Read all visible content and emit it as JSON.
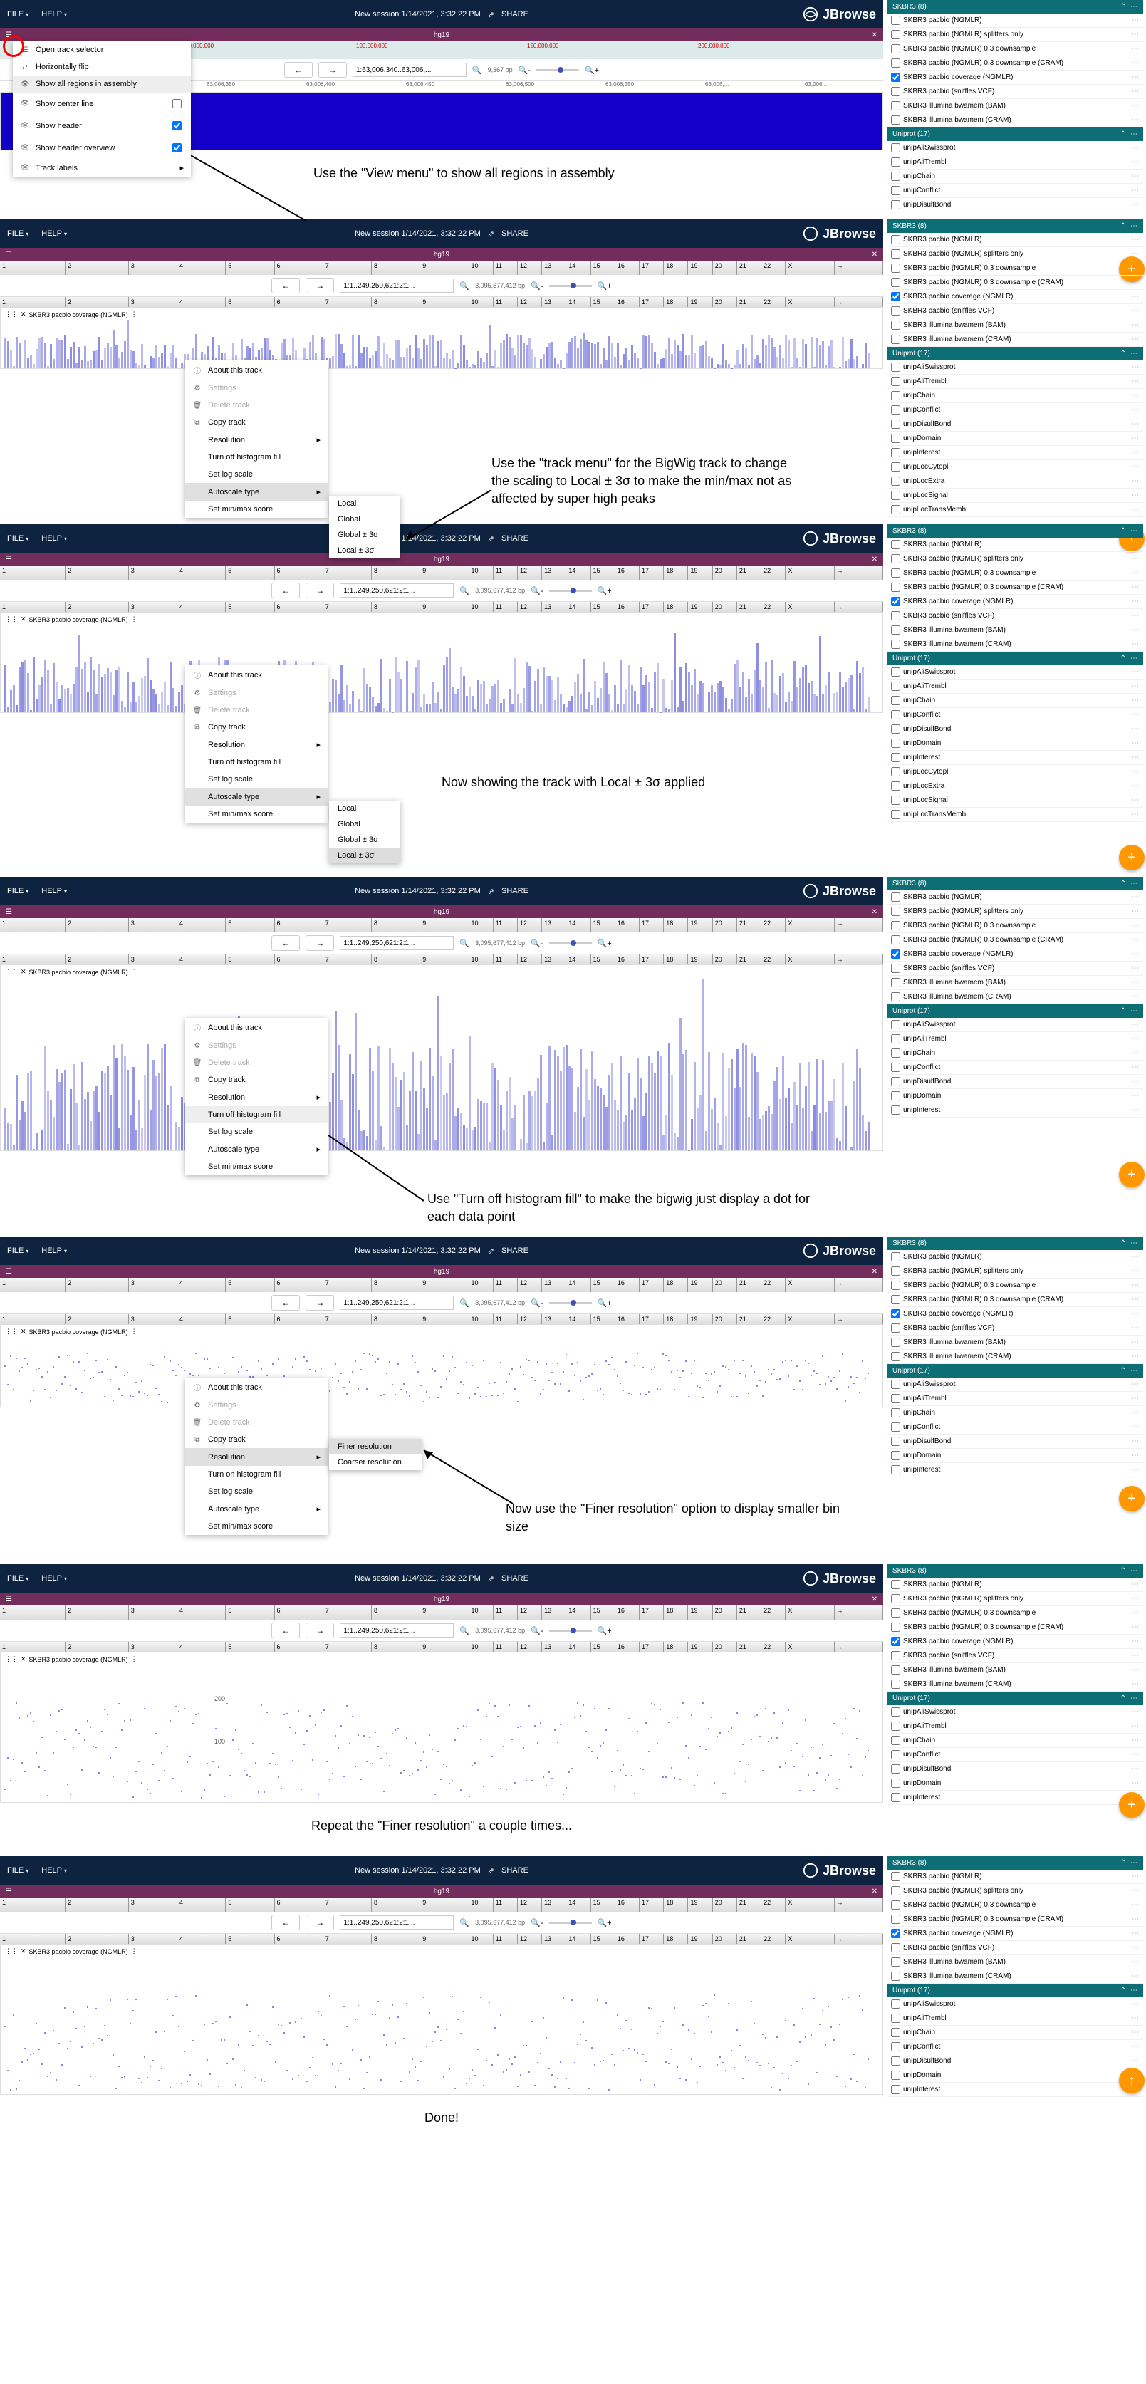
{
  "header": {
    "file": "FILE",
    "help": "HELP",
    "session": "New session 1/14/2021, 3:32:22 PM",
    "share": "SHARE",
    "logo": "JBrowse"
  },
  "assembly": "hg19",
  "loc1": "1:63,006,340..63,006,...",
  "loc2": "1:1..249,250,621:2:1...",
  "bp1": "9,367 bp",
  "bp2": "3,095,677,412 bp",
  "ruler1": [
    "50,000,000",
    "100,000,000",
    "150,000,000",
    "200,000,000"
  ],
  "ruler1b": [
    "63,006,350",
    "63,006,400",
    "63,006,450",
    "63,006,500",
    "63,006,550",
    "63,006,...",
    "63,006,..."
  ],
  "chroms": [
    "1",
    "2",
    "3",
    "4",
    "5",
    "6",
    "7",
    "8",
    "9",
    "10",
    "11",
    "12",
    "13",
    "14",
    "15",
    "16",
    "17",
    "18",
    "19",
    "20",
    "21",
    "22",
    "X",
    "→"
  ],
  "viewMenu": {
    "items": [
      {
        "icon": "☰",
        "label": "Open track selector"
      },
      {
        "icon": "⇄",
        "label": "Horizontally flip"
      },
      {
        "icon": "👁",
        "label": "Show all regions in assembly",
        "hov": true
      },
      {
        "icon": "👁",
        "label": "Show center line",
        "check": false
      },
      {
        "icon": "👁",
        "label": "Show header",
        "check": true
      },
      {
        "icon": "👁",
        "label": "Show header overview",
        "check": true
      },
      {
        "icon": "👁",
        "label": "Track labels",
        "arrow": true
      }
    ]
  },
  "trackMenu": {
    "items": [
      {
        "icon": "ⓘ",
        "label": "About this track"
      },
      {
        "icon": "⚙",
        "label": "Settings",
        "dis": true
      },
      {
        "icon": "🗑",
        "label": "Delete track",
        "dis": true
      },
      {
        "icon": "⧉",
        "label": "Copy track"
      },
      {
        "label": "Resolution",
        "arrow": true
      },
      {
        "label": "Turn off histogram fill"
      },
      {
        "label": "Set log scale"
      },
      {
        "label": "Autoscale type",
        "arrow": true
      },
      {
        "label": "Set min/max score"
      }
    ]
  },
  "trackMenuOn": {
    "items": [
      {
        "icon": "ⓘ",
        "label": "About this track"
      },
      {
        "icon": "⚙",
        "label": "Settings",
        "dis": true
      },
      {
        "icon": "🗑",
        "label": "Delete track",
        "dis": true
      },
      {
        "icon": "⧉",
        "label": "Copy track"
      },
      {
        "label": "Resolution",
        "arrow": true
      },
      {
        "label": "Turn on histogram fill"
      },
      {
        "label": "Set log scale"
      },
      {
        "label": "Autoscale type",
        "arrow": true
      },
      {
        "label": "Set min/max score"
      }
    ]
  },
  "autoscaleSub": [
    "Local",
    "Global",
    "Global ± 3σ",
    "Local ± 3σ"
  ],
  "resolutionSub": [
    "Finer resolution",
    "Coarser resolution"
  ],
  "trackName": "SKBR3 pacbio coverage (NGMLR)",
  "annotations": {
    "a1": "Use the \"View menu\" to show all regions in assembly",
    "a2": "Use the \"track menu\" for the BigWig track to change the scaling to Local ± 3σ to make the min/max not as affected by super high peaks",
    "a3": "Now showing the track with Local ± 3σ applied",
    "a4": "Use \"Turn off histogram fill\" to make the bigwig just display a dot for each data point",
    "a5": "Now use the \"Finer resolution\" option to display smaller bin size",
    "a6": "Repeat the \"Finer resolution\" a couple times...",
    "a7": "Done!"
  },
  "side": {
    "skbr3": {
      "title": "SKBR3 (8)",
      "items": [
        {
          "l": "SKBR3 pacbio (NGMLR)"
        },
        {
          "l": "SKBR3 pacbio (NGMLR) splitters only"
        },
        {
          "l": "SKBR3 pacbio (NGMLR) 0.3 downsample"
        },
        {
          "l": "SKBR3 pacbio (NGMLR) 0.3 downsample (CRAM)"
        },
        {
          "l": "SKBR3 pacbio coverage (NGMLR)",
          "c": true
        },
        {
          "l": "SKBR3 pacbio (sniffles VCF)"
        },
        {
          "l": "SKBR3 illumina bwamem (BAM)"
        },
        {
          "l": "SKBR3 illumina bwamem (CRAM)"
        }
      ]
    },
    "uniprot": {
      "title": "Uniprot (17)",
      "items": [
        {
          "l": "unipAliSwissprot"
        },
        {
          "l": "unipAliTrembl"
        },
        {
          "l": "unipChain"
        },
        {
          "l": "unipConflict"
        },
        {
          "l": "unipDisulfBond"
        },
        {
          "l": "unipDomain"
        },
        {
          "l": "unipInterest"
        },
        {
          "l": "unipLocCytopl"
        },
        {
          "l": "unipLocExtra"
        },
        {
          "l": "unipLocSignal"
        },
        {
          "l": "unipLocTransMemb"
        }
      ]
    },
    "uniprotShort": {
      "title": "Uniprot (17)",
      "items": [
        {
          "l": "unipAliSwissprot"
        },
        {
          "l": "unipAliTrembl"
        },
        {
          "l": "unipChain"
        },
        {
          "l": "unipConflict"
        },
        {
          "l": "unipDisulfBond"
        },
        {
          "l": "unipDomain"
        },
        {
          "l": "unipInterest"
        }
      ]
    }
  },
  "gridVals": [
    "200",
    "100"
  ]
}
